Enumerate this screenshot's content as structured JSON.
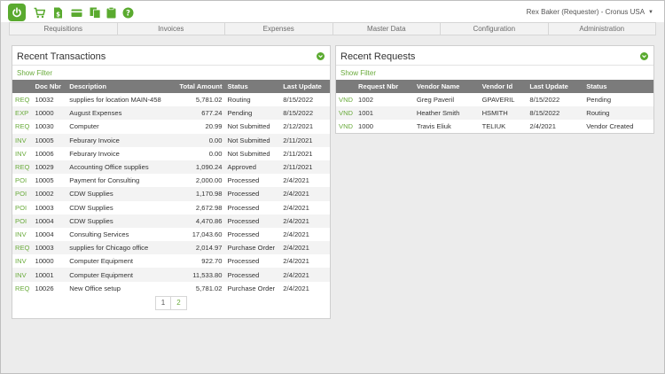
{
  "header": {
    "user": "Rex Baker (Requester) - Cronus USA",
    "icons": [
      "power-icon",
      "cart-icon",
      "dollar-document-icon",
      "credit-card-icon",
      "copy-icon",
      "clipboard-icon",
      "help-icon"
    ],
    "accent_color": "#5aaa2f"
  },
  "nav": {
    "items": [
      "Requisitions",
      "Invoices",
      "Expenses",
      "Master Data",
      "Configuration",
      "Administration"
    ]
  },
  "transactions": {
    "title": "Recent Transactions",
    "show_filter": "Show Filter",
    "columns": [
      "",
      "Doc Nbr",
      "Description",
      "Total Amount",
      "Status",
      "Last Update"
    ],
    "rows": [
      {
        "type": "REQ",
        "doc": "10032",
        "desc": "supplies for location MAIN-458",
        "amount": "5,781.02",
        "status": "Routing",
        "updated": "8/15/2022"
      },
      {
        "type": "EXP",
        "doc": "10000",
        "desc": "August Expenses",
        "amount": "677.24",
        "status": "Pending",
        "updated": "8/15/2022"
      },
      {
        "type": "REQ",
        "doc": "10030",
        "desc": "Computer",
        "amount": "20.99",
        "status": "Not Submitted",
        "updated": "2/12/2021"
      },
      {
        "type": "INV",
        "doc": "10005",
        "desc": "Feburary Invoice",
        "amount": "0.00",
        "status": "Not Submitted",
        "updated": "2/11/2021"
      },
      {
        "type": "INV",
        "doc": "10006",
        "desc": "Feburary Invoice",
        "amount": "0.00",
        "status": "Not Submitted",
        "updated": "2/11/2021"
      },
      {
        "type": "REQ",
        "doc": "10029",
        "desc": "Accounting Office supplies",
        "amount": "1,090.24",
        "status": "Approved",
        "updated": "2/11/2021"
      },
      {
        "type": "POI",
        "doc": "10005",
        "desc": "Payment for Consulting",
        "amount": "2,000.00",
        "status": "Processed",
        "updated": "2/4/2021"
      },
      {
        "type": "POI",
        "doc": "10002",
        "desc": "CDW Supplies",
        "amount": "1,170.98",
        "status": "Processed",
        "updated": "2/4/2021"
      },
      {
        "type": "POI",
        "doc": "10003",
        "desc": "CDW Supplies",
        "amount": "2,672.98",
        "status": "Processed",
        "updated": "2/4/2021"
      },
      {
        "type": "POI",
        "doc": "10004",
        "desc": "CDW Supplies",
        "amount": "4,470.86",
        "status": "Processed",
        "updated": "2/4/2021"
      },
      {
        "type": "INV",
        "doc": "10004",
        "desc": "Consulting Services",
        "amount": "17,043.60",
        "status": "Processed",
        "updated": "2/4/2021"
      },
      {
        "type": "REQ",
        "doc": "10003",
        "desc": "supplies for Chicago office",
        "amount": "2,014.97",
        "status": "Purchase Order",
        "updated": "2/4/2021"
      },
      {
        "type": "INV",
        "doc": "10000",
        "desc": "Computer Equipment",
        "amount": "922.70",
        "status": "Processed",
        "updated": "2/4/2021"
      },
      {
        "type": "INV",
        "doc": "10001",
        "desc": "Computer Equipment",
        "amount": "11,533.80",
        "status": "Processed",
        "updated": "2/4/2021"
      },
      {
        "type": "REQ",
        "doc": "10026",
        "desc": "New Office setup",
        "amount": "5,781.02",
        "status": "Purchase Order",
        "updated": "2/4/2021"
      }
    ],
    "pages": [
      "1",
      "2"
    ]
  },
  "requests": {
    "title": "Recent Requests",
    "show_filter": "Show Filter",
    "columns": [
      "",
      "Request Nbr",
      "Vendor Name",
      "Vendor Id",
      "Last Update",
      "Status"
    ],
    "rows": [
      {
        "type": "VND",
        "nbr": "1002",
        "vendor": "Greg Paveril",
        "vid": "GPAVERIL",
        "updated": "8/15/2022",
        "status": "Pending"
      },
      {
        "type": "VND",
        "nbr": "1001",
        "vendor": "Heather Smith",
        "vid": "HSMITH",
        "updated": "8/15/2022",
        "status": "Routing"
      },
      {
        "type": "VND",
        "nbr": "1000",
        "vendor": "Travis Eliuk",
        "vid": "TELIUK",
        "updated": "2/4/2021",
        "status": "Vendor Created"
      }
    ]
  }
}
